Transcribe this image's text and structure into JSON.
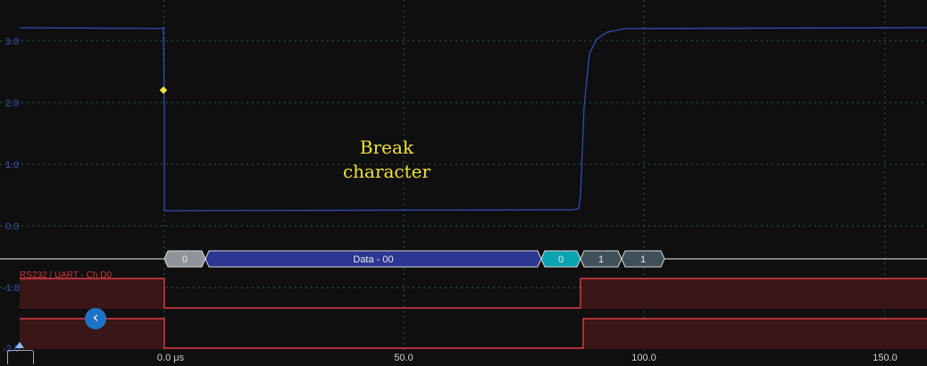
{
  "analog": {
    "y_ticks": [
      "3.0",
      "2.0",
      "1.0",
      "0.0",
      "-1.0",
      "-2.0"
    ],
    "trace_color": "#2f4fb2"
  },
  "time_axis": {
    "ticks": [
      "0.0 μs",
      "50.0",
      "100.0",
      "150.0"
    ]
  },
  "annotation": {
    "line1": "Break",
    "line2": "character",
    "color": "#f2e23a"
  },
  "decoder": {
    "channel_label": "RS232 / UART - Ch D0",
    "frames": [
      {
        "text": "0",
        "kind": "start"
      },
      {
        "text": "Data - 00",
        "kind": "data"
      },
      {
        "text": "0",
        "kind": "parity"
      },
      {
        "text": "1",
        "kind": "stop"
      },
      {
        "text": "1",
        "kind": "stop"
      }
    ]
  },
  "digital": {
    "color": "#e23b47"
  },
  "controls": {
    "back_icon": "chevron-left-icon",
    "marker_icon": "ruler-marker-icon"
  }
}
